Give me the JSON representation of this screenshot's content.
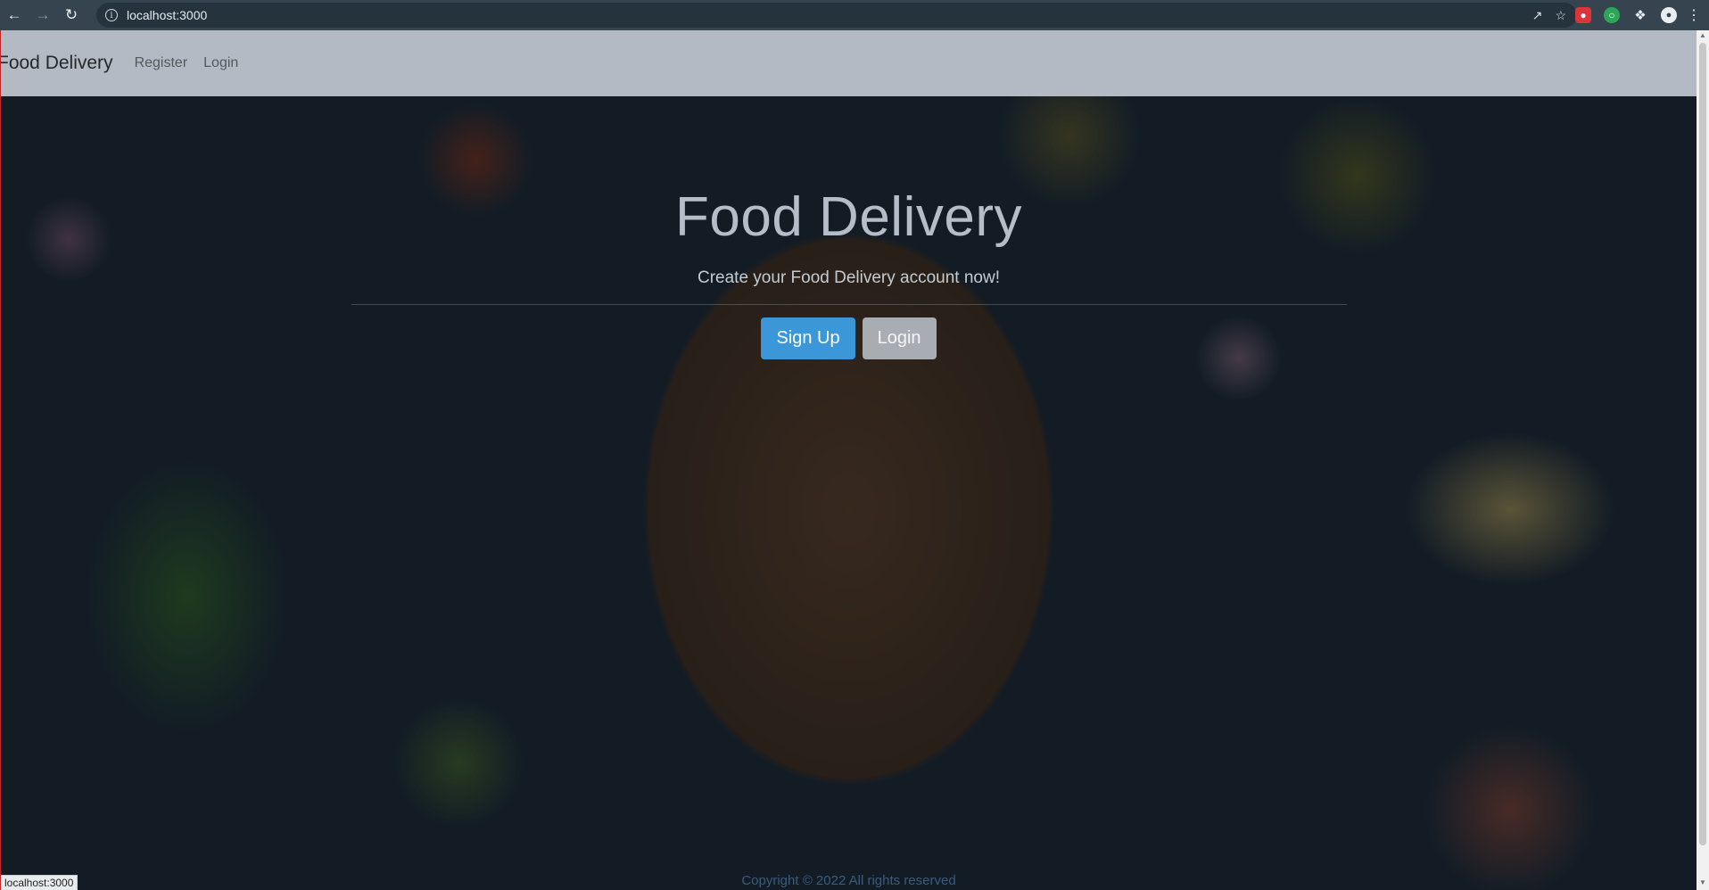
{
  "browser": {
    "url": "localhost:3000",
    "status_url": "localhost:3000"
  },
  "navbar": {
    "brand": "Food Delivery",
    "links": [
      "Register",
      "Login"
    ]
  },
  "hero": {
    "title": "Food Delivery",
    "subtitle": "Create your Food Delivery account now!",
    "signup_label": "Sign Up",
    "login_label": "Login"
  },
  "footer": {
    "text": "Copyright © 2022 All rights reserved"
  },
  "colors": {
    "navbar_bg": "#b3bac3",
    "primary_button": "#3b97d8",
    "secondary_button": "#a7adb3"
  }
}
